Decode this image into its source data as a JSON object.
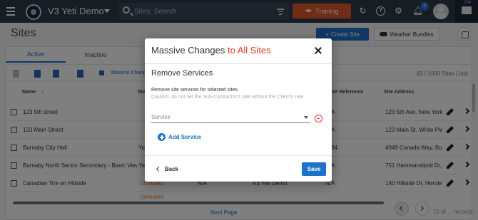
{
  "header": {
    "app_title": "V3 Yeti Demo",
    "search_placeholder": "Sites: Search",
    "training_label": "Training",
    "notification_count": "3",
    "message_count": "294"
  },
  "page": {
    "title": "Sites",
    "create_site_label": "Create Site",
    "weather_bundles_label": "Weather Bundles"
  },
  "tabs": [
    {
      "label": "Active",
      "active": true
    },
    {
      "label": "Inactive",
      "active": false
    }
  ],
  "toolbar": {
    "massive_changes_label": "Massive Changes",
    "limit_text": "83 / 1000 Sites Limit"
  },
  "table": {
    "headers": {
      "name": "Name",
      "status": "Sta",
      "client_reference": "ent Reference",
      "site_address": "Site Address"
    },
    "rows": [
      {
        "name": "123 5th street",
        "status": "",
        "col_a": "",
        "col_b": "",
        "client_ref": "A",
        "address": "123 5th Ave, New York"
      },
      {
        "name": "123 Main Street",
        "status": "",
        "col_a": "",
        "col_b": "",
        "client_ref": "A",
        "address": "123 Main St, White Plain"
      },
      {
        "name": "Burnaby City Hall",
        "status": "Yes",
        "col_a": "",
        "col_b": "",
        "client_ref": "34",
        "address": "4949 Canada Way, Burn"
      },
      {
        "name": "Burnaby North Senior Secondary - Basic View",
        "status": "Yes",
        "col_a": "",
        "col_b": "",
        "client_ref": "A",
        "address": "751 Hammarskjold Dr, B"
      },
      {
        "name": "Canadian Tire on Hillside",
        "status": "Unrouted",
        "col_a": "N/A",
        "col_b": "V3 Yeti Demo",
        "client_ref": "N/A",
        "address": "140 Hillside Dr, Hender"
      }
    ],
    "partial_row_status": "Unrouted"
  },
  "pagination": {
    "next_page_label": "Next Page",
    "records_text": "15 of ... records"
  },
  "dialog": {
    "title_main": "Massive Changes",
    "title_accent": "to All Sites",
    "section_title": "Remove Services",
    "description": "Remove site services for selected sites.",
    "caution": "Caution: do not set the Sub-Contractor's rate without the Client's rate.",
    "service_placeholder": "Service",
    "add_service_label": "Add Service",
    "back_label": "Back",
    "save_label": "Save"
  },
  "colors": {
    "topbar": "#2f3a4a",
    "primary": "#1e72c9",
    "accent_red": "#e0392b",
    "training_orange": "#e05b2b",
    "unrouted_orange": "#e07a2a"
  }
}
